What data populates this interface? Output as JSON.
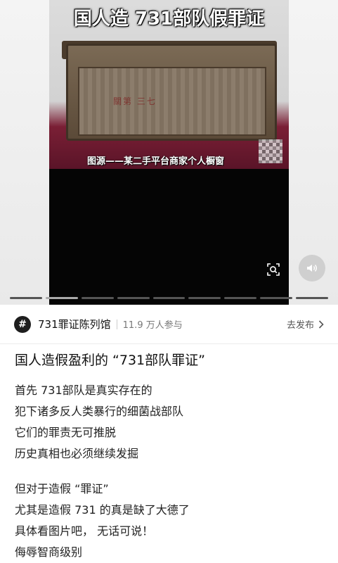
{
  "video": {
    "overlay_title": "国人造 731部队假罪证",
    "photo_credit": "图源——某二手平台商家个人橱窗",
    "box_stamp_text": "關第 三七",
    "progress": {
      "segments": 9,
      "active_segment": 1
    }
  },
  "topic": {
    "icon": "hash-icon",
    "name": "731罪证陈列馆",
    "participants": "11.9 万人参与",
    "publish_label": "去发布"
  },
  "post": {
    "title": "国人造假盈利的 “731部队罪证”",
    "lines": [
      "首先 731部队是真实存在的",
      "犯下诸多反人类暴行的细菌战部队",
      "它们的罪责无可推脱",
      "历史真相也必须继续发掘",
      "",
      "但对于造假 “罪证”",
      "尤其是造假 731 的真是缺了大德了",
      "具体看图片吧， 无话可说！",
      "侮辱智商级别"
    ]
  }
}
